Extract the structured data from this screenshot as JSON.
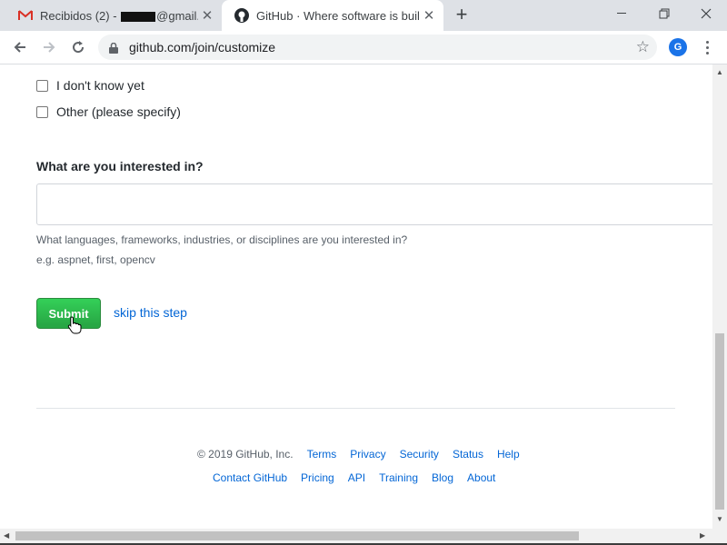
{
  "browser": {
    "tabs": [
      {
        "title_prefix": "Recibidos (2) - ",
        "title_suffix": "@gmail.co",
        "icon": "gmail-icon",
        "active": false
      },
      {
        "title": "GitHub · Where software is built",
        "icon": "github-icon",
        "active": true
      }
    ],
    "new_tab": "+",
    "url": "github.com/join/customize",
    "profile_initial": "G"
  },
  "page": {
    "checkbox_options": [
      {
        "label": "I don't know yet",
        "checked": false
      },
      {
        "label": "Other (please specify)",
        "checked": false
      }
    ],
    "interests": {
      "heading": "What are you interested in?",
      "value": "",
      "help": "What languages, frameworks, industries, or disciplines are you interested in?",
      "example": "e.g. aspnet, first, opencv"
    },
    "submit_label": "Submit",
    "skip_label": "skip this step"
  },
  "footer": {
    "copyright": "© 2019 GitHub, Inc.",
    "row1_links": [
      "Terms",
      "Privacy",
      "Security",
      "Status",
      "Help"
    ],
    "row2_links": [
      "Contact GitHub",
      "Pricing",
      "API",
      "Training",
      "Blog",
      "About"
    ]
  },
  "colors": {
    "accent": "#0366d6",
    "submit": "#28a745",
    "chrome_frame": "#dee1e6"
  }
}
